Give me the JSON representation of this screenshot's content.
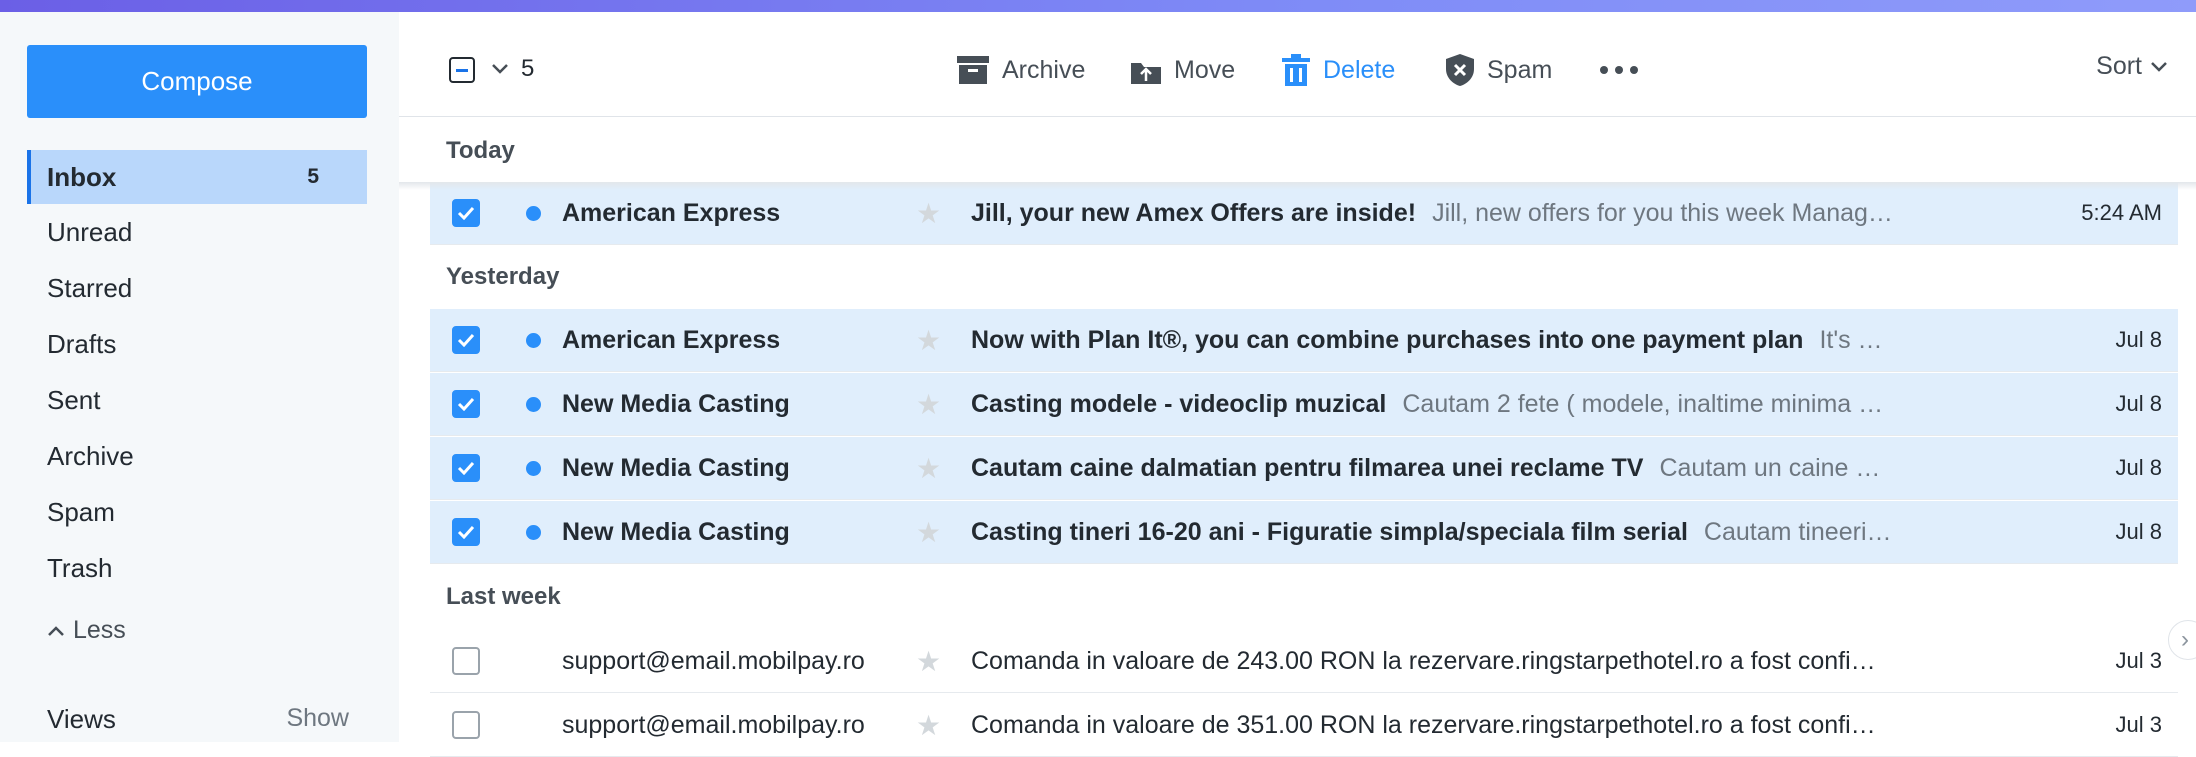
{
  "sidebar": {
    "compose_label": "Compose",
    "folders": [
      {
        "label": "Inbox",
        "count": "5",
        "active": true
      },
      {
        "label": "Unread"
      },
      {
        "label": "Starred"
      },
      {
        "label": "Drafts"
      },
      {
        "label": "Sent"
      },
      {
        "label": "Archive"
      },
      {
        "label": "Spam"
      },
      {
        "label": "Trash"
      }
    ],
    "less_label": "Less",
    "views_label": "Views",
    "views_show": "Show"
  },
  "toolbar": {
    "selected_count": "5",
    "archive_label": "Archive",
    "move_label": "Move",
    "delete_label": "Delete",
    "spam_label": "Spam",
    "sort_label": "Sort"
  },
  "groups": {
    "today": "Today",
    "yesterday": "Yesterday",
    "last_week": "Last week"
  },
  "messages": [
    {
      "sender": "American Express",
      "subject": "Jill, your new Amex Offers are inside!",
      "snippet": "Jill, new offers for you this week Manag…",
      "date": "5:24 AM",
      "checked": true,
      "unread": true
    },
    {
      "sender": "American Express",
      "subject": "Now with Plan It®, you can combine purchases into one payment plan",
      "snippet": "It's …",
      "date": "Jul 8",
      "checked": true,
      "unread": true
    },
    {
      "sender": "New Media Casting",
      "subject": "Casting modele - videoclip muzical",
      "snippet": "Cautam 2 fete ( modele, inaltime minima …",
      "date": "Jul 8",
      "checked": true,
      "unread": true
    },
    {
      "sender": "New Media Casting",
      "subject": "Cautam caine dalmatian pentru filmarea unei reclame TV",
      "snippet": "Cautam un caine …",
      "date": "Jul 8",
      "checked": true,
      "unread": true
    },
    {
      "sender": "New Media Casting",
      "subject": "Casting tineri 16-20 ani - Figuratie simpla/speciala film serial",
      "snippet": "Cautam tineeri…",
      "date": "Jul 8",
      "checked": true,
      "unread": true
    },
    {
      "sender": "support@email.mobilpay.ro",
      "subject": "Comanda in valoare de 243.00 RON la rezervare.ringstarpethotel.ro a fost confi…",
      "snippet": "",
      "date": "Jul 3",
      "checked": false,
      "unread": false
    },
    {
      "sender": "support@email.mobilpay.ro",
      "subject": "Comanda in valoare de 351.00 RON la rezervare.ringstarpethotel.ro a fost confi…",
      "snippet": "",
      "date": "Jul 3",
      "checked": false,
      "unread": false
    }
  ],
  "colors": {
    "accent": "#2a8ffa",
    "selected_row": "#e0eefc",
    "active_folder": "#b9d7fb"
  }
}
